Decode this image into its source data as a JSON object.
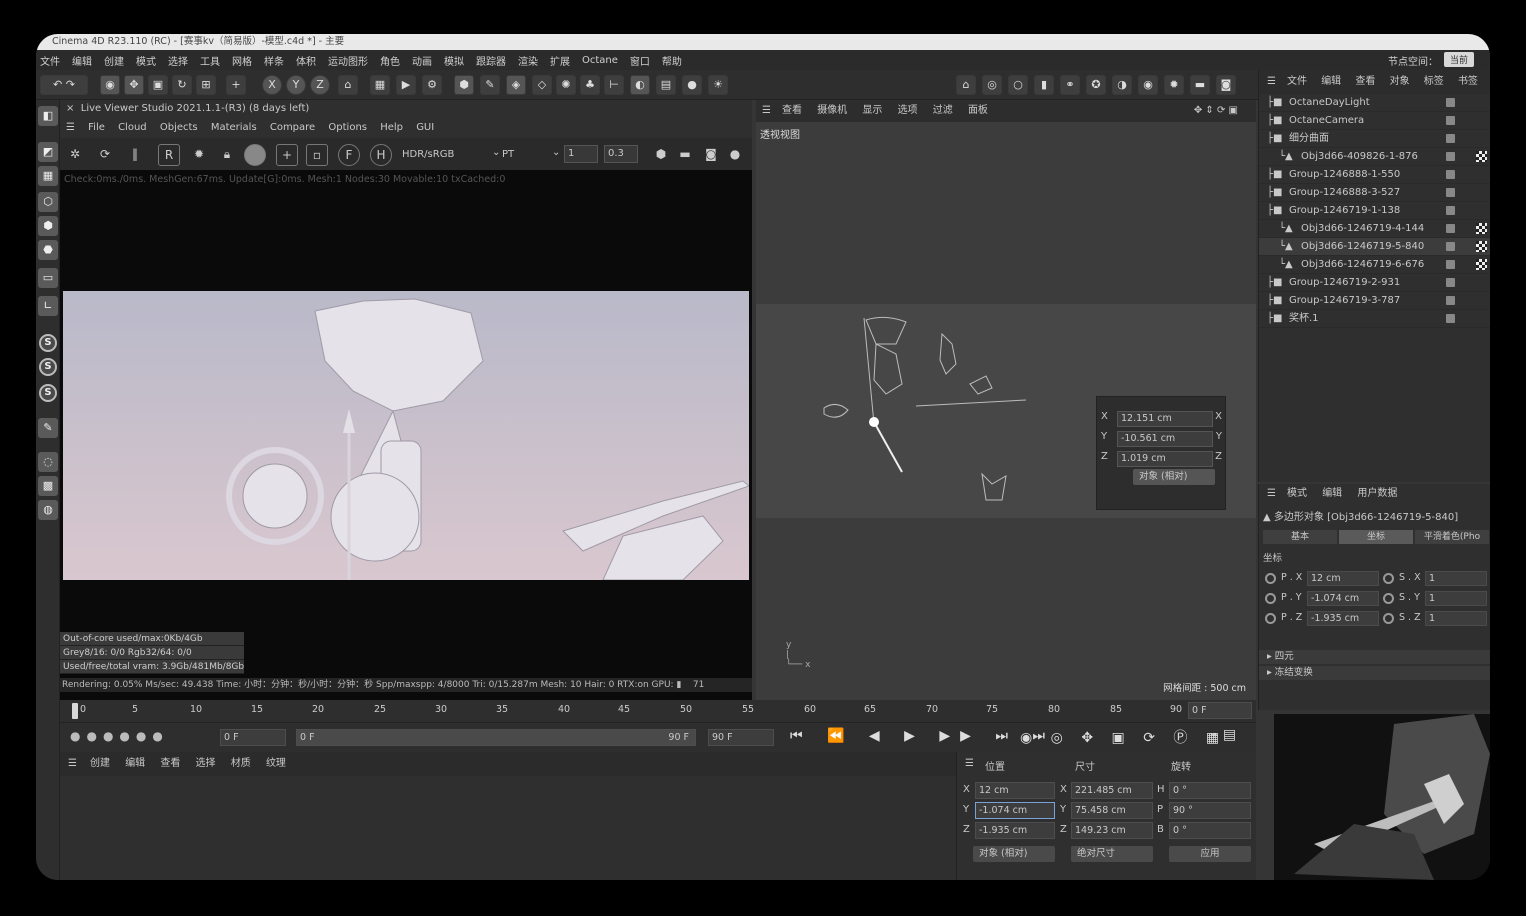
{
  "window": {
    "title": "Cinema 4D R23.110 (RC) - [赛事kv（简易版）-模型.c4d *] - 主要"
  },
  "menubar": {
    "items": [
      "文件",
      "编辑",
      "创建",
      "模式",
      "选择",
      "工具",
      "网格",
      "样条",
      "体积",
      "运动图形",
      "角色",
      "动画",
      "模拟",
      "跟踪器",
      "渲染",
      "扩展",
      "Octane",
      "窗口",
      "帮助"
    ],
    "node_space": "节点空间：",
    "node_space_btn": "当前"
  },
  "toolbar": {
    "axis_x": "X",
    "axis_y": "Y",
    "axis_z": "Z"
  },
  "live_viewer": {
    "title": "Live Viewer Studio 2021.1.1-(R3) (8 days left)",
    "menu": [
      "File",
      "Cloud",
      "Objects",
      "Materials",
      "Compare",
      "Options",
      "Help",
      "GUI"
    ],
    "color_space": "HDR/sRGB",
    "kernel": "PT",
    "value1": "1",
    "value2": "0.3",
    "status": "Check:0ms./0ms. MeshGen:67ms. Update[G]:0ms. Mesh:1 Nodes:30 Movable:10 txCached:0",
    "stats": [
      "Out-of-core used/max:0Kb/4Gb",
      "Grey8/16: 0/0          Rgb32/64: 0/0",
      "Used/free/total vram: 3.9Gb/481Mb/8Gb"
    ],
    "rendering": "Rendering: 0.05%   Ms/sec: 49.438   Time: 小时：分钟：秒/小时：分钟：秒   Spp/maxspp: 4/8000   Tri: 0/15.287m   Mesh: 10   Hair: 0   RTX:on   GPU:",
    "gpu_value": "71"
  },
  "viewport": {
    "menu": [
      "查看",
      "摄像机",
      "显示",
      "选项",
      "过滤",
      "面板"
    ],
    "label": "透视视图",
    "grid_spacing": "网格间距 : 500 cm",
    "coord_x": "12.151 cm",
    "coord_y": "-10.561 cm",
    "coord_z": "1.019 cm",
    "coord_mode": "对象 (相对)",
    "axis_labels": [
      "X",
      "Y",
      "Z"
    ]
  },
  "timeline": {
    "ticks": [
      "0",
      "5",
      "10",
      "15",
      "20",
      "25",
      "30",
      "35",
      "40",
      "45",
      "50",
      "55",
      "60",
      "65",
      "70",
      "75",
      "80",
      "85",
      "90"
    ],
    "current_frame": "0 F"
  },
  "playback": {
    "start": "0 F",
    "range_start": "0 F",
    "range_end": "90 F",
    "end": "90 F"
  },
  "material_manager": {
    "menu": [
      "创建",
      "编辑",
      "查看",
      "选择",
      "材质",
      "纹理"
    ]
  },
  "coordinates": {
    "headers": [
      "位置",
      "尺寸",
      "旋转"
    ],
    "pos": {
      "x": "12 cm",
      "y": "-1.074 cm",
      "z": "-1.935 cm"
    },
    "size": {
      "x": "221.485 cm",
      "y": "75.458 cm",
      "z": "149.23 cm"
    },
    "rot": {
      "h": "0 °",
      "p": "90 °",
      "b": "0 °"
    },
    "mode1": "对象 (相对)",
    "mode2": "绝对尺寸",
    "apply": "应用"
  },
  "object_manager": {
    "menu": [
      "文件",
      "编辑",
      "查看",
      "对象",
      "标签",
      "书签"
    ],
    "objects": [
      {
        "name": "OctaneDayLight",
        "indent": 0
      },
      {
        "name": "OctaneCamera",
        "indent": 0
      },
      {
        "name": "细分曲面",
        "indent": 0
      },
      {
        "name": "Obj3d66-409826-1-876",
        "indent": 1
      },
      {
        "name": "Group-1246888-1-550",
        "indent": 0
      },
      {
        "name": "Group-1246888-3-527",
        "indent": 0
      },
      {
        "name": "Group-1246719-1-138",
        "indent": 0
      },
      {
        "name": "Obj3d66-1246719-4-144",
        "indent": 1
      },
      {
        "name": "Obj3d66-1246719-5-840",
        "indent": 1
      },
      {
        "name": "Obj3d66-1246719-6-676",
        "indent": 1
      },
      {
        "name": "Group-1246719-2-931",
        "indent": 0
      },
      {
        "name": "Group-1246719-3-787",
        "indent": 0
      },
      {
        "name": "奖杯.1",
        "indent": 0
      }
    ]
  },
  "attributes": {
    "menu": [
      "模式",
      "编辑",
      "用户数据"
    ],
    "object_label": "多边形对象 [Obj3d66-1246719-5-840]",
    "tabs": [
      "基本",
      "坐标",
      "平滑着色(Pho"
    ],
    "section": "坐标",
    "px_label": "P . X",
    "px": "12 cm",
    "py_label": "P . Y",
    "py": "-1.074 cm",
    "pz_label": "P . Z",
    "pz": "-1.935 cm",
    "sx_label": "S . X",
    "sx": "1",
    "sy_label": "S . Y",
    "sy": "1",
    "sz_label": "S . Z",
    "sz": "1",
    "quaternion": "四元",
    "freeze": "冻结变换"
  },
  "colors": {
    "accent": "#5b8fd6",
    "bg": "#353535"
  }
}
